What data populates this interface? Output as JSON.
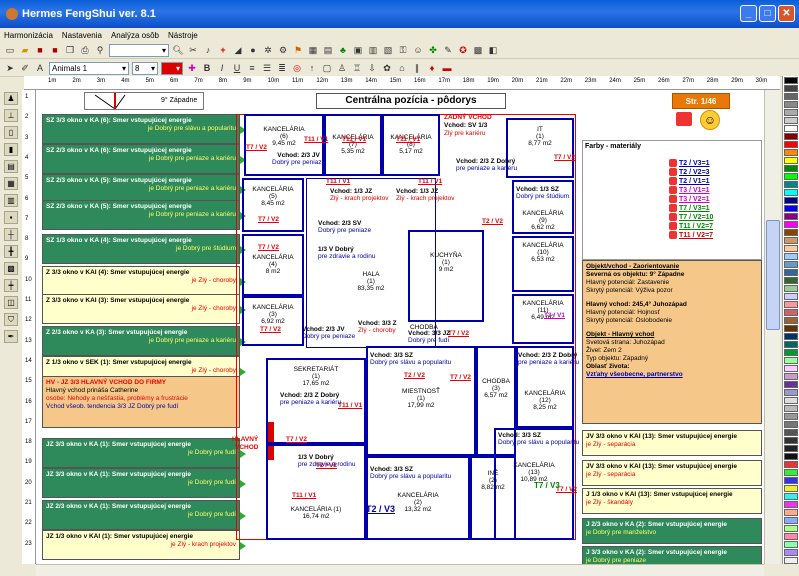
{
  "window": {
    "title": "Hermes FengShui ver. 8.1"
  },
  "menu": [
    "Harmonizácia",
    "Nastavenia",
    "Analýza osôb",
    "Nástroje"
  ],
  "toolbar": {
    "font": "Animals 1",
    "size": "8",
    "bold": "B",
    "italic": "I",
    "underline": "U"
  },
  "ruler": {
    "units": [
      "1m",
      "2m",
      "3m",
      "4m",
      "5m",
      "6m",
      "7m",
      "8m",
      "9m",
      "10m",
      "11m",
      "12m",
      "13m",
      "14m",
      "15m",
      "16m",
      "17m",
      "18m",
      "19m",
      "20m",
      "21m",
      "22m",
      "23m",
      "24m",
      "25m",
      "26m",
      "27m",
      "28m",
      "29m",
      "30m"
    ],
    "left": [
      "1",
      "2",
      "3",
      "4",
      "5",
      "6",
      "7",
      "8",
      "9",
      "10",
      "11",
      "12",
      "13",
      "14",
      "15",
      "16",
      "17",
      "18",
      "19",
      "20",
      "21",
      "22",
      "23"
    ]
  },
  "header": {
    "direction": "9° Západne",
    "title": "Centrálna pozícia - pôdorys",
    "page": "Str. 1/46"
  },
  "left_notes": [
    {
      "t": "SZ 3/3 okno v KA (6): Smer vstupujúcej energie",
      "v": "je Dobrý pre slávu a popularitu"
    },
    {
      "t": "SZ 2/3 okno v KA (6): Smer vstupujúcej energie",
      "v": "je Dobrý pre peniaze a kariéru"
    },
    {
      "t": "SZ 2/3 okno v KA (5): Smer vstupujúcej energie",
      "v": "je Dobrý pre peniaze a kariéru"
    },
    {
      "t": "SZ 2/3 okno v KA (5): Smer vstupujúcej energie",
      "v": "je Dobrý pre peniaze a kariéru"
    },
    {
      "t": "SZ 1/3 okno v KA (4): Smer vstupujúcej energie",
      "v": "je Dobrý pre štúdium"
    },
    {
      "t": "Z 3/3 okno v KAI (4): Smer vstupujúcej energie",
      "v": "je Zlý - choroby"
    },
    {
      "t": "Z 3/3 okno v KAI (3): Smer vstupujúcej energie",
      "v": "je Zlý - choroby"
    },
    {
      "t": "Z 2/3 okno v KA (3): Smer vstupujúcej energie",
      "v": "je Dobrý pre peniaze a kariéru"
    },
    {
      "t": "Z 1/3 okno v SEK (1): Smer vstupujúcej energie",
      "v": "je Zlý - choroby"
    },
    {
      "t": "JZ 3/3 okno v KA (1): Smer vstupujúcej energie",
      "v": "je Dobrý pre fudí"
    },
    {
      "t": "JZ 3/3 okno v KA (1): Smer vstupujúcej energie",
      "v": "je Dobrý pre fudí"
    },
    {
      "t": "JZ 2/3 okno v KA (1): Smer vstupujúcej energie",
      "v": "je Dobrý pre fudí"
    },
    {
      "t": "JZ 1/3 okno v KAI (1): Smer vstupujúcej energie",
      "v": "je Zlý - krach projektov"
    }
  ],
  "main_entry": {
    "head": "HV - JZ 3/3 HLAVNÝ VCHOD DO FIRMY",
    "l1": "Hlavný vchod prináša Catherine",
    "l2": "osobe: Nehody a nešťastia, problémy a frustrácie",
    "l3": "Vchod všeob. tendencia 3/3 JZ Dobrý pre fudí",
    "label1": "HLAVNÝ",
    "label2": "VCHOD"
  },
  "rooms": [
    {
      "name": "KANCELÁRIA",
      "num": "(6)",
      "area": "9,45 m2"
    },
    {
      "name": "KANCELÁRIA",
      "num": "(7)",
      "area": "5,35 m2"
    },
    {
      "name": "KANCELÁRIA",
      "num": "(8)",
      "area": "5,17 m2"
    },
    {
      "name": "IT",
      "num": "(1)",
      "area": "8,77 m2"
    },
    {
      "name": "KANCELÁRIA",
      "num": "(5)",
      "area": "8,45 m2"
    },
    {
      "name": "KANCELÁRIA",
      "num": "(4)",
      "area": "8 m2"
    },
    {
      "name": "KANCELÁRIA",
      "num": "(3)",
      "area": "6,92 m2"
    },
    {
      "name": "HALA",
      "num": "(1)",
      "area": "83,35 m2"
    },
    {
      "name": "KUCHYŇA",
      "num": "(1)",
      "area": "9 m2"
    },
    {
      "name": "KANCELÁRIA",
      "num": "(9)",
      "area": "6,62 m2"
    },
    {
      "name": "KANCELÁRIA",
      "num": "(10)",
      "area": "6,53 m2"
    },
    {
      "name": "KANCELÁRIA",
      "num": "(11)",
      "area": "6,49 m2"
    },
    {
      "name": "SEKRETARIÁT",
      "num": "(1)",
      "area": "17,65 m2"
    },
    {
      "name": "MIESTNOSŤ",
      "num": "(1)",
      "area": "17,99 m2"
    },
    {
      "name": "CHODBA",
      "num": "(3)",
      "area": "6,57 m2"
    },
    {
      "name": "KANCELÁRIA",
      "num": "(12)",
      "area": "8,25 m2"
    },
    {
      "name": "KANCELÁRIA",
      "num": "(2)",
      "area": "13,32 m2"
    },
    {
      "name": "INÉ",
      "num": "(2)",
      "area": "8,82 m2"
    },
    {
      "name": "KANCELÁRIA",
      "num": "(13)",
      "area": "10,89 m2"
    },
    {
      "name": "KANCELÁRIA (1)",
      "num": "",
      "area": "16,74 m2"
    }
  ],
  "labels": {
    "back_entry": "ZADNÝ VCHOD",
    "back_entry_v": "Vchod: SV 1/3",
    "back_entry_e": "Zlý pre kariéru",
    "t11v1": "T11 / V1",
    "t7v2": "T7 / V2",
    "t2v2": "T2 / V2",
    "t2v3": "T2 / V3",
    "t7v3": "T7 / V3",
    "t3v1": "T3 / V1",
    "v_2_3_jv": "Vchod: 2/3 JV",
    "dobry_peniaze": "Dobrý pre peniaze",
    "v_1_3_jz": "Vchod: 1/3 JZ",
    "zly_krach": "Zlý - krach projektov",
    "v_2_3_z": "Vchod: 2/3 Z Dobrý",
    "peniaze_kariera": "pre peniaze a kariéru",
    "v_1_3_sz": "Vchod: 1/3 SZ",
    "dobry_studium": "Dobrý pre štúdium",
    "v_2_3_sv": "Vchod: 2/3 SV",
    "v_1_3_v": "1/3 V Dobrý",
    "zdravie": "pre zdravie a rodinu",
    "v_3_3_jz": "Vchod: 3/3 JZ",
    "dobry_fudi": "Dobrý pre fudí",
    "v_3_3_z": "Vchod: 3/3 Z",
    "zly_choroby": "Zlý - choroby",
    "v_3_3_sz": "Vchod: 3/3 SZ",
    "slava": "Dobrý pre slávu a popularitu",
    "chodba": "CHODBA",
    "chodba_area": "(2) 4,76 m2"
  },
  "legend_title": "Farby - materiály",
  "legend": [
    "T2 / V3=1",
    "T2 / V2=3",
    "T2 / V1=1",
    "T3 / V1=1",
    "T3 / V2=1",
    "T7 / V3=1",
    "T7 / V2=10",
    "T11 / V2=7",
    "T11 / V2=7"
  ],
  "object_panel": {
    "h1": "Objekt/vchod - Zaorientovanie",
    "l1": "Severná os objektu: 9° Západne",
    "l2": "Hlavný potenciál: Zastavenie",
    "l3": "Skrytý potenciál: Výživa pozor",
    "l4": "Hlavný vchod: 245,4° Juhozápad",
    "l5": "Hlavný potenciál: Hojnosť",
    "l6": "Skrytý potenciál: Oslobodenie",
    "h2": "Objekt - Hlavný vchod",
    "l7": "Svetová strana: Juhozápad",
    "l8": "Živel: Zem 2",
    "l9": "Typ objektu: Západný",
    "l10": "Oblasť života:",
    "l11": "Vzťahy všeobecne, partnerstvo"
  },
  "right_notes": [
    {
      "t": "JV 3/3 okno v KAI (13): Smer vstupujúcej energie",
      "v": "je Zlý - separácia"
    },
    {
      "t": "JV 3/3 okno v KAI (13): Smer vstupujúcej energie",
      "v": "je Zlý - separácia"
    },
    {
      "t": "J 1/3 okno v KAI (13): Smer vstupujúcej energie",
      "v": "je Zlý - škandály"
    },
    {
      "t": "J 2/3 okno v KA (2): Smer vstupujúcej energie",
      "v": "je Dobrý pre manželstvo"
    },
    {
      "t": "J 3/3 okno v KA (2): Smer vstupujúcej energie",
      "v": "je Dobrý pre peniaze"
    }
  ],
  "colors": {
    "accent": "#0000aa",
    "good": "#2e8a5a",
    "bad": "#e00000",
    "panel": "#f5c88a"
  }
}
